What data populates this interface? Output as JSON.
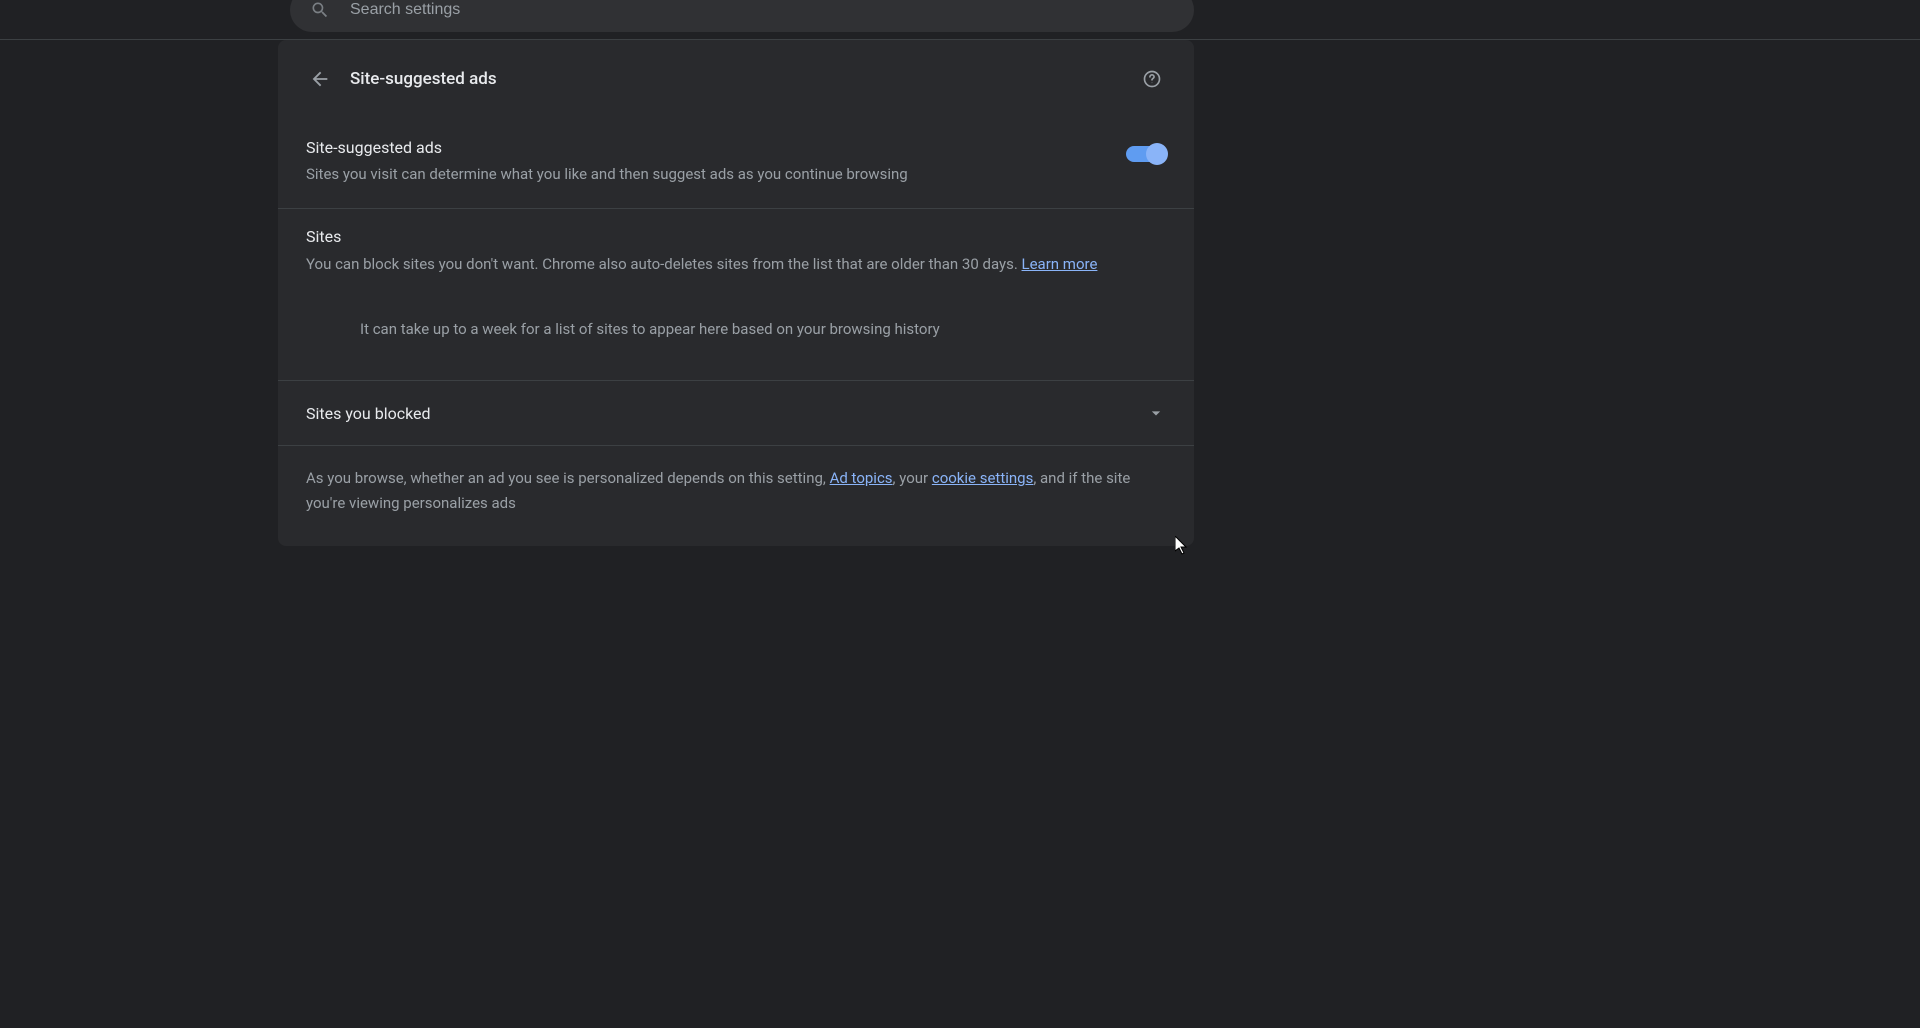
{
  "search": {
    "placeholder": "Search settings"
  },
  "header": {
    "title": "Site-suggested ads"
  },
  "main_toggle": {
    "title": "Site-suggested ads",
    "description": "Sites you visit can determine what you like and then suggest ads as you continue browsing"
  },
  "sites_section": {
    "title": "Sites",
    "description": "You can block sites you don't want. Chrome also auto-deletes sites from the list that are older than 30 days. ",
    "learn_more": "Learn more"
  },
  "info_message": "It can take up to a week for a list of sites to appear here based on your browsing history",
  "blocked_row": {
    "title": "Sites you blocked"
  },
  "footer": {
    "text_before": "As you browse, whether an ad you see is personalized depends on this setting, ",
    "link1": "Ad topics",
    "text_mid": ", your ",
    "link2": "cookie settings",
    "text_after": ", and if the site you're viewing personalizes ads"
  }
}
